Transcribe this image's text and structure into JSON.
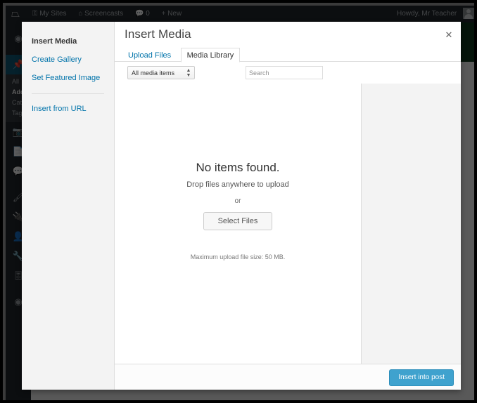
{
  "adminbar": {
    "logo_icon": "wordpress-logo-icon",
    "items": [
      {
        "label": "My Sites",
        "icon": "key-icon",
        "glyph": "⚷"
      },
      {
        "label": "Screencasts",
        "icon": "home-icon",
        "glyph": "⌂"
      },
      {
        "label": "0",
        "icon": "comment-bubble-icon",
        "glyph": "■"
      },
      {
        "label": "New",
        "icon": "plus-icon",
        "glyph": "+"
      }
    ],
    "howdy": "Howdy, Mr Teacher"
  },
  "adminmenu": {
    "icons": [
      {
        "name": "dashboard-icon",
        "glyph": "◔"
      },
      {
        "name": "posts-pin-icon",
        "glyph": "✒"
      },
      {
        "name": "media-icon",
        "glyph": "▣"
      },
      {
        "name": "pages-icon",
        "glyph": "❐"
      },
      {
        "name": "comments-icon",
        "glyph": "■"
      },
      {
        "name": "appearance-brush-icon",
        "glyph": "✎"
      },
      {
        "name": "plugins-plug-icon",
        "glyph": "⚡"
      },
      {
        "name": "users-icon",
        "glyph": "♟"
      },
      {
        "name": "tools-wrench-icon",
        "glyph": "⚒"
      },
      {
        "name": "settings-icon",
        "glyph": "⚙"
      },
      {
        "name": "collapse-menu-icon",
        "glyph": "◀"
      }
    ],
    "submenu": [
      {
        "label": "All",
        "current": false
      },
      {
        "label": "Add",
        "current": true
      },
      {
        "label": "Cat",
        "current": false
      },
      {
        "label": "Tag",
        "current": false
      }
    ]
  },
  "modal": {
    "title": "Insert Media",
    "close_icon": "close-icon",
    "menu": [
      {
        "label": "Insert Media",
        "active": true
      },
      {
        "label": "Create Gallery",
        "active": false
      },
      {
        "label": "Set Featured Image",
        "active": false
      },
      {
        "label": "Insert from URL",
        "active": false
      }
    ],
    "tabs": [
      {
        "label": "Upload Files",
        "active": false
      },
      {
        "label": "Media Library",
        "active": true
      }
    ],
    "toolbar": {
      "filter_value": "All media items",
      "filter_options": [
        "All media items"
      ],
      "search_placeholder": "Search",
      "search_value": ""
    },
    "content": {
      "no_items": "No items found.",
      "drop_text": "Drop files anywhere to upload",
      "or_text": "or",
      "select_files_label": "Select Files",
      "max_upload": "Maximum upload file size: 50 MB."
    },
    "footer": {
      "insert_label": "Insert into post"
    }
  },
  "colors": {
    "accent_blue": "#0073aa",
    "button_blue": "#3fa2ce",
    "adminbar_dark": "#23282d",
    "green_block": "#10361c"
  }
}
